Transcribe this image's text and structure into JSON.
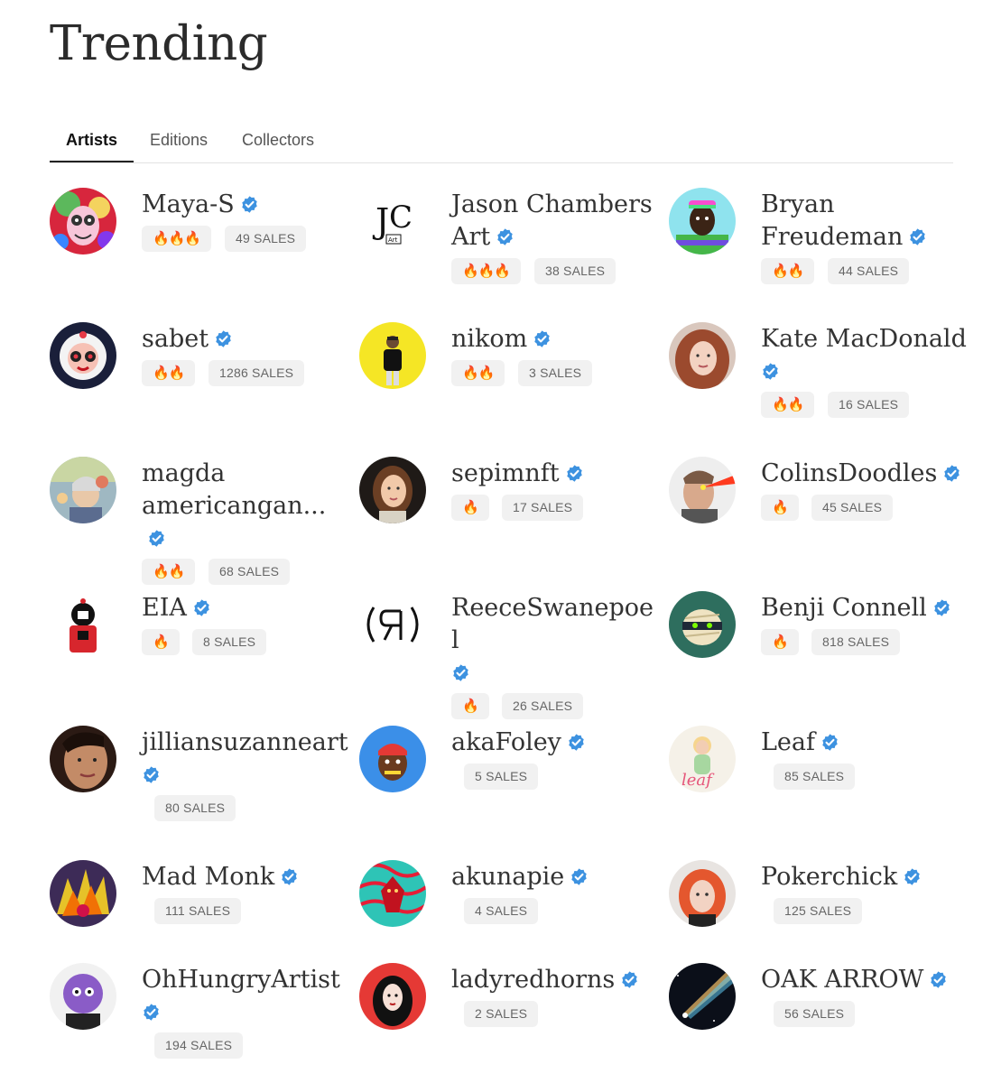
{
  "header": {
    "title": "Trending"
  },
  "tabs": [
    {
      "label": "Artists",
      "active": true
    },
    {
      "label": "Editions",
      "active": false
    },
    {
      "label": "Collectors",
      "active": false
    }
  ],
  "colors": {
    "verified": "#3d92e0",
    "pill_bg": "#f1f1f1",
    "active_tab_underline": "#222222"
  },
  "artists": [
    {
      "name": "Maya-S",
      "fire": "🔥🔥🔥",
      "sales": "49 SALES",
      "verified": true,
      "avatar_icon": "psychedelic-art-avatar"
    },
    {
      "name": "Jason Chambers Art",
      "fire": "🔥🔥🔥",
      "sales": "38 SALES",
      "verified": true,
      "avatar_icon": "jc-art-logo-avatar"
    },
    {
      "name": "Bryan Freudeman",
      "fire": "🔥🔥",
      "sales": "44 SALES",
      "verified": true,
      "avatar_icon": "cartoon-man-cap-avatar"
    },
    {
      "name": "sabet",
      "fire": "🔥🔥",
      "sales": "1286 SALES",
      "verified": true,
      "avatar_icon": "astronaut-avatar"
    },
    {
      "name": "nikom",
      "fire": "🔥🔥",
      "sales": "3 SALES",
      "verified": true,
      "avatar_icon": "man-yellow-bg-avatar"
    },
    {
      "name": "Kate MacDonald",
      "fire": "🔥🔥",
      "sales": "16 SALES",
      "verified": true,
      "avatar_icon": "woman-red-hair-avatar"
    },
    {
      "name": "magda americangan...",
      "fire": "🔥🔥",
      "sales": "68 SALES",
      "verified": true,
      "avatar_icon": "collage-woman-avatar"
    },
    {
      "name": "sepimnft",
      "fire": "🔥",
      "sales": "17 SALES",
      "verified": true,
      "avatar_icon": "woman-portrait-avatar"
    },
    {
      "name": "ColinsDoodles",
      "fire": "🔥",
      "sales": "45 SALES",
      "verified": true,
      "avatar_icon": "laser-eyes-man-avatar"
    },
    {
      "name": "EIA",
      "fire": "🔥",
      "sales": "8 SALES",
      "verified": true,
      "avatar_icon": "cartoon-red-figure-avatar"
    },
    {
      "name": "ReeceSwanepoel",
      "fire": "🔥",
      "sales": "26 SALES",
      "verified": true,
      "avatar_icon": "rs-logo-avatar"
    },
    {
      "name": "Benji Connell",
      "fire": "🔥",
      "sales": "818 SALES",
      "verified": true,
      "avatar_icon": "mummy-character-avatar"
    },
    {
      "name": "jilliansuzanneart",
      "fire": "",
      "sales": "80 SALES",
      "verified": true,
      "avatar_icon": "woman-closeup-avatar"
    },
    {
      "name": "akaFoley",
      "fire": "",
      "sales": "5 SALES",
      "verified": true,
      "avatar_icon": "bandana-character-avatar"
    },
    {
      "name": "Leaf",
      "fire": "",
      "sales": "85 SALES",
      "verified": true,
      "avatar_icon": "leaf-illustration-avatar"
    },
    {
      "name": "Mad Monk",
      "fire": "",
      "sales": "111 SALES",
      "verified": true,
      "avatar_icon": "spiky-creature-avatar"
    },
    {
      "name": "akunapie",
      "fire": "",
      "sales": "4 SALES",
      "verified": true,
      "avatar_icon": "dragon-pattern-avatar"
    },
    {
      "name": "Pokerchick",
      "fire": "",
      "sales": "125 SALES",
      "verified": true,
      "avatar_icon": "red-hair-girl-avatar"
    },
    {
      "name": "OhHungryArtist",
      "fire": "",
      "sales": "194 SALES",
      "verified": true,
      "avatar_icon": "purple-face-avatar"
    },
    {
      "name": "ladyredhorns",
      "fire": "",
      "sales": "2 SALES",
      "verified": true,
      "avatar_icon": "dark-hair-woman-avatar"
    },
    {
      "name": "OAK ARROW",
      "fire": "",
      "sales": "56 SALES",
      "verified": true,
      "avatar_icon": "light-beam-space-avatar"
    }
  ]
}
